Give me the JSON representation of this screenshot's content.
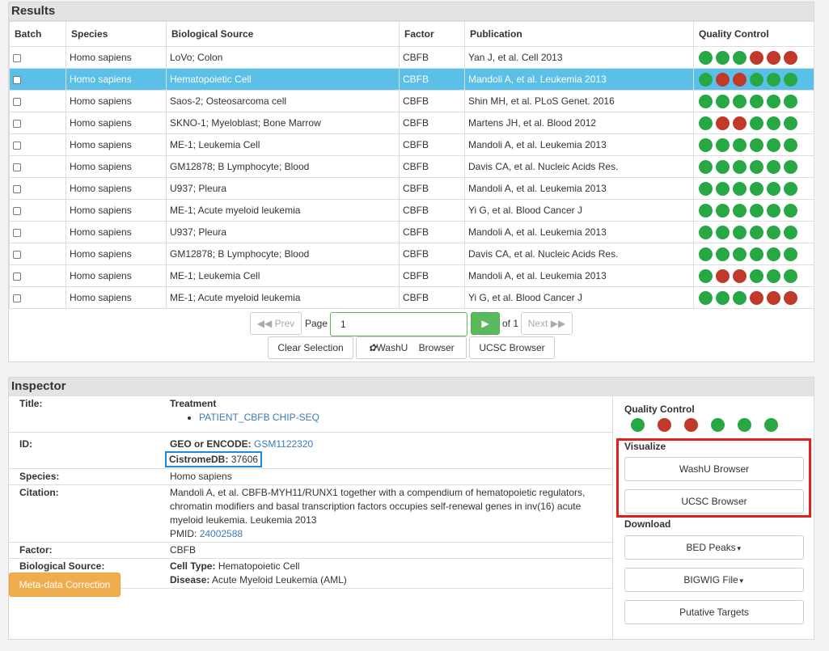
{
  "results": {
    "title": "Results",
    "columns": [
      "Batch",
      "Species",
      "Biological Source",
      "Factor",
      "Publication",
      "Quality Control"
    ],
    "rows": [
      {
        "species": "Homo sapiens",
        "source": "LoVo; Colon",
        "factor": "CBFB",
        "publication": "Yan J, et al. Cell 2013",
        "qc": [
          "g",
          "g",
          "g",
          "r",
          "r",
          "r"
        ]
      },
      {
        "species": "Homo sapiens",
        "source": "Hematopoietic Cell",
        "factor": "CBFB",
        "publication": "Mandoli A, et al. Leukemia 2013",
        "qc": [
          "g",
          "r",
          "r",
          "g",
          "g",
          "g"
        ],
        "selected": true
      },
      {
        "species": "Homo sapiens",
        "source": "Saos-2; Osteosarcoma cell",
        "factor": "CBFB",
        "publication": "Shin MH, et al. PLoS Genet. 2016",
        "qc": [
          "g",
          "g",
          "g",
          "g",
          "g",
          "g"
        ]
      },
      {
        "species": "Homo sapiens",
        "source": "SKNO-1; Myeloblast; Bone Marrow",
        "factor": "CBFB",
        "publication": "Martens JH, et al. Blood 2012",
        "qc": [
          "g",
          "r",
          "r",
          "g",
          "g",
          "g"
        ]
      },
      {
        "species": "Homo sapiens",
        "source": "ME-1; Leukemia Cell",
        "factor": "CBFB",
        "publication": "Mandoli A, et al. Leukemia 2013",
        "qc": [
          "g",
          "g",
          "g",
          "g",
          "g",
          "g"
        ]
      },
      {
        "species": "Homo sapiens",
        "source": "GM12878; B Lymphocyte; Blood",
        "factor": "CBFB",
        "publication": "Davis CA, et al. Nucleic Acids Res.",
        "qc": [
          "g",
          "g",
          "g",
          "g",
          "g",
          "g"
        ]
      },
      {
        "species": "Homo sapiens",
        "source": "U937; Pleura",
        "factor": "CBFB",
        "publication": "Mandoli A, et al. Leukemia 2013",
        "qc": [
          "g",
          "g",
          "g",
          "g",
          "g",
          "g"
        ]
      },
      {
        "species": "Homo sapiens",
        "source": "ME-1; Acute myeloid leukemia",
        "factor": "CBFB",
        "publication": "Yi G, et al. Blood Cancer J",
        "qc": [
          "g",
          "g",
          "g",
          "g",
          "g",
          "g"
        ]
      },
      {
        "species": "Homo sapiens",
        "source": "U937; Pleura",
        "factor": "CBFB",
        "publication": "Mandoli A, et al. Leukemia 2013",
        "qc": [
          "g",
          "g",
          "g",
          "g",
          "g",
          "g"
        ]
      },
      {
        "species": "Homo sapiens",
        "source": "GM12878; B Lymphocyte; Blood",
        "factor": "CBFB",
        "publication": "Davis CA, et al. Nucleic Acids Res.",
        "qc": [
          "g",
          "g",
          "g",
          "g",
          "g",
          "g"
        ]
      },
      {
        "species": "Homo sapiens",
        "source": "ME-1; Leukemia Cell",
        "factor": "CBFB",
        "publication": "Mandoli A, et al. Leukemia 2013",
        "qc": [
          "g",
          "r",
          "r",
          "g",
          "g",
          "g"
        ]
      },
      {
        "species": "Homo sapiens",
        "source": "ME-1; Acute myeloid leukemia",
        "factor": "CBFB",
        "publication": "Yi G, et al. Blood Cancer J",
        "qc": [
          "g",
          "g",
          "g",
          "r",
          "r",
          "r"
        ]
      }
    ],
    "pager": {
      "prev": "Prev",
      "page_label": "Page",
      "page_value": "1",
      "of_label": "of 1",
      "next": "Next"
    },
    "actions": {
      "clear": "Clear Selection",
      "washu": "WashU",
      "washu_suffix": "Browser",
      "ucsc": "UCSC Browser"
    }
  },
  "inspector": {
    "title": "Inspector",
    "title_label": "Title:",
    "treatment_label": "Treatment",
    "treatment_item": "PATIENT_CBFB CHIP-SEQ",
    "id_label": "ID:",
    "geo_label": "GEO or ENCODE:",
    "geo_value": "GSM1122320",
    "cistrome_label": "CistromeDB:",
    "cistrome_value": "37606",
    "species_label": "Species:",
    "species_value": "Homo sapiens",
    "citation_label": "Citation:",
    "citation_text": "Mandoli A, et al. CBFB-MYH11/RUNX1 together with a compendium of hematopoietic regulators, chromatin modifiers and basal transcription factors occupies self-renewal genes in inv(16) acute myeloid leukemia. Leukemia 2013",
    "pmid_label": "PMID:",
    "pmid_value": "24002588",
    "factor_label": "Factor:",
    "factor_value": "CBFB",
    "biosource_label": "Biological Source:",
    "celltype_label": "Cell Type:",
    "celltype_value": "Hematopoietic Cell",
    "disease_label": "Disease:",
    "disease_value": "Acute Myeloid Leukemia (AML)",
    "meta_button": "Meta-data Correction",
    "side": {
      "qc_label": "Quality Control",
      "qc": [
        "g",
        "r",
        "r",
        "g",
        "g",
        "g"
      ],
      "visualize_label": "Visualize",
      "washu": "WashU Browser",
      "ucsc": "UCSC Browser",
      "download_label": "Download",
      "bed": "BED Peaks",
      "bigwig": "BIGWIG File",
      "targets": "Putative Targets"
    }
  },
  "colors": {
    "qc_good": "#28a745",
    "qc_bad": "#c0392b",
    "selected_row": "#5bc0e8",
    "highlight_red": "#e02020",
    "highlight_blue": "#1e88e5"
  }
}
